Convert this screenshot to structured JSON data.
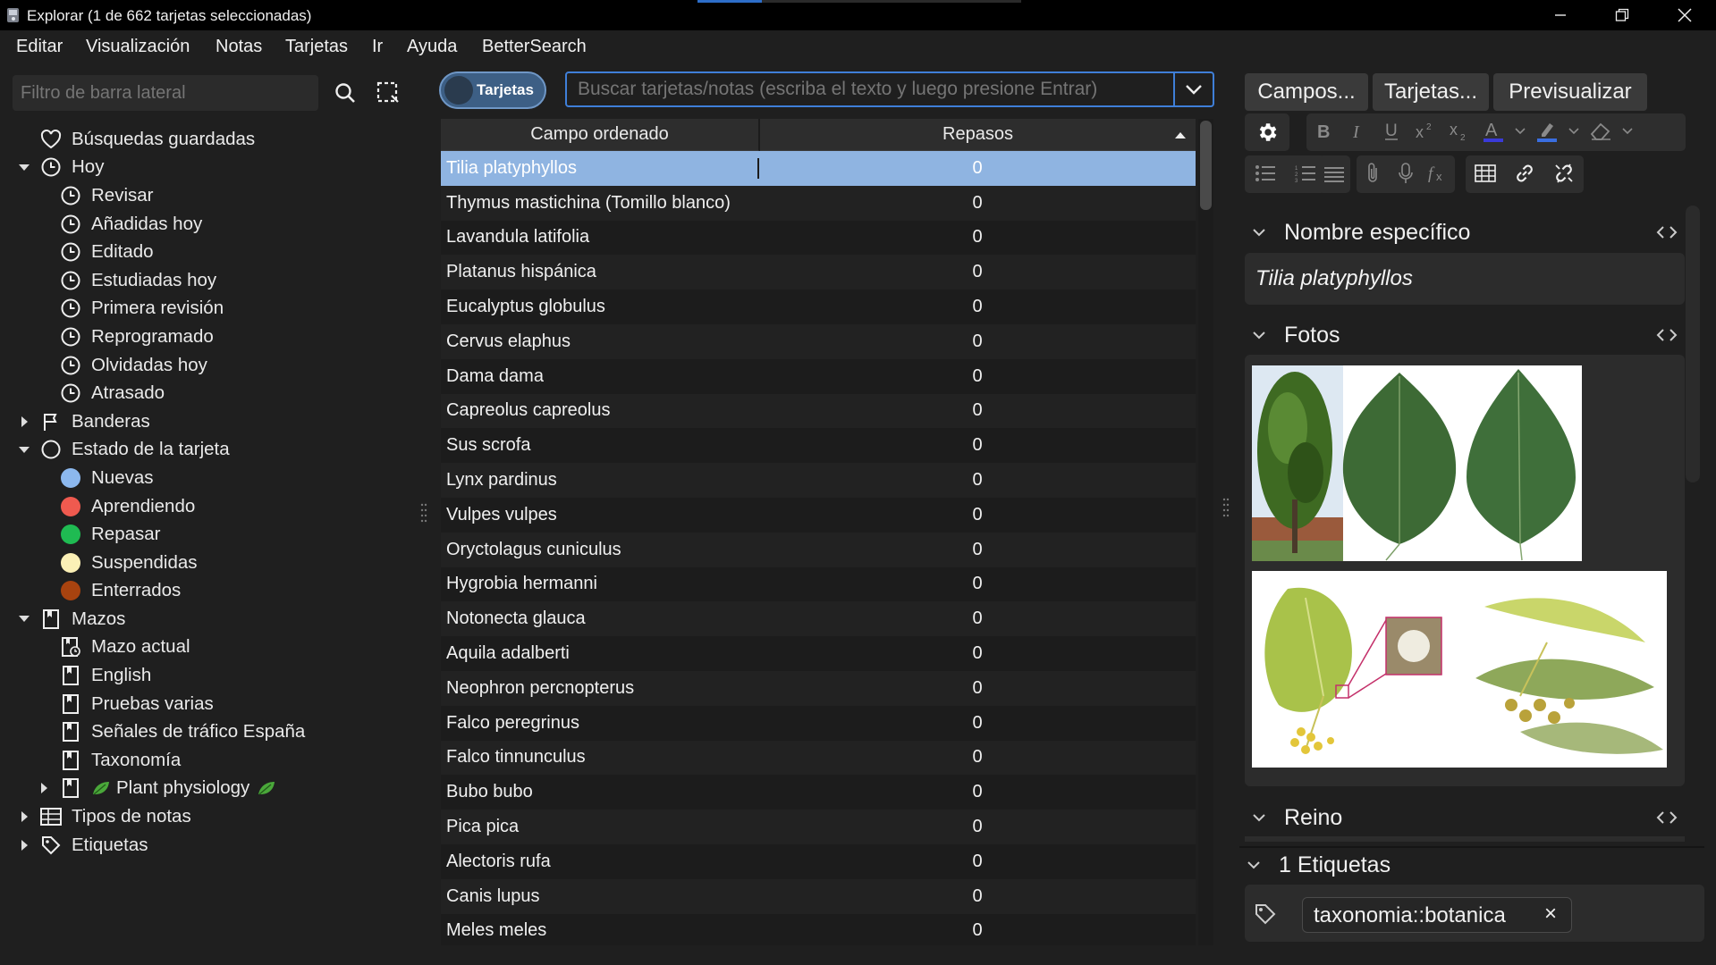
{
  "window": {
    "title": "Explorar (1 de 662 tarjetas seleccionadas)",
    "minimize_icon": "minimize-icon",
    "restore_icon": "restore-icon",
    "close_icon": "close-icon"
  },
  "menu": [
    "Editar",
    "Visualización",
    "Notas",
    "Tarjetas",
    "Ir",
    "Ayuda",
    "BetterSearch"
  ],
  "sidebar": {
    "filter_placeholder": "Filtro de barra lateral",
    "tree": [
      {
        "label": "Búsquedas guardadas",
        "icon": "heart-icon",
        "level": 0,
        "arrow": ""
      },
      {
        "label": "Hoy",
        "icon": "clock-icon",
        "level": 0,
        "arrow": "expanded"
      },
      {
        "label": "Revisar",
        "icon": "clock-icon",
        "level": 1,
        "arrow": ""
      },
      {
        "label": "Añadidas hoy",
        "icon": "clock-icon",
        "level": 1,
        "arrow": ""
      },
      {
        "label": "Editado",
        "icon": "clock-icon",
        "level": 1,
        "arrow": ""
      },
      {
        "label": "Estudiadas hoy",
        "icon": "clock-icon",
        "level": 1,
        "arrow": ""
      },
      {
        "label": "Primera revisión",
        "icon": "clock-icon",
        "level": 1,
        "arrow": ""
      },
      {
        "label": "Reprogramado",
        "icon": "clock-icon",
        "level": 1,
        "arrow": ""
      },
      {
        "label": "Olvidadas hoy",
        "icon": "clock-icon",
        "level": 1,
        "arrow": ""
      },
      {
        "label": "Atrasado",
        "icon": "clock-icon",
        "level": 1,
        "arrow": ""
      },
      {
        "label": "Banderas",
        "icon": "flag-icon",
        "level": 0,
        "arrow": "collapsed"
      },
      {
        "label": "Estado de la tarjeta",
        "icon": "circle-icon",
        "level": 0,
        "arrow": "expanded"
      },
      {
        "label": "Nuevas",
        "icon": "dot-icon",
        "color": "#8cb8ee",
        "level": 1,
        "arrow": ""
      },
      {
        "label": "Aprendiendo",
        "icon": "dot-icon",
        "color": "#ef5a4f",
        "level": 1,
        "arrow": ""
      },
      {
        "label": "Repasar",
        "icon": "dot-icon",
        "color": "#1fbb52",
        "level": 1,
        "arrow": ""
      },
      {
        "label": "Suspendidas",
        "icon": "dot-icon",
        "color": "#fbf0b6",
        "level": 1,
        "arrow": ""
      },
      {
        "label": "Enterrados",
        "icon": "dot-icon",
        "color": "#a8430f",
        "level": 1,
        "arrow": ""
      },
      {
        "label": "Mazos",
        "icon": "deck-icon",
        "level": 0,
        "arrow": "expanded"
      },
      {
        "label": "Mazo actual",
        "icon": "current-deck-icon",
        "level": 1,
        "arrow": ""
      },
      {
        "label": "English",
        "icon": "deck-icon",
        "level": 1,
        "arrow": ""
      },
      {
        "label": "Pruebas varias",
        "icon": "deck-icon",
        "level": 1,
        "arrow": ""
      },
      {
        "label": "Señales de tráfico España",
        "icon": "deck-icon",
        "level": 1,
        "arrow": ""
      },
      {
        "label": "Taxonomía",
        "icon": "deck-icon",
        "level": 1,
        "arrow": ""
      },
      {
        "label": "Plant physiology",
        "icon": "deck-icon",
        "level": 1,
        "arrow": "collapsed",
        "leaf": true
      },
      {
        "label": "Tipos de notas",
        "icon": "notetype-icon",
        "level": 0,
        "arrow": "collapsed"
      },
      {
        "label": "Etiquetas",
        "icon": "tag-icon",
        "level": 0,
        "arrow": "collapsed"
      }
    ]
  },
  "toggle_label": "Tarjetas",
  "search_placeholder": "Buscar tarjetas/notas (escriba el texto y luego presione Entrar)",
  "table": {
    "headers": [
      "Campo ordenado",
      "Repasos"
    ],
    "rows": [
      [
        "Tilia platyphyllos",
        "0"
      ],
      [
        "Thymus mastichina (Tomillo blanco)",
        "0"
      ],
      [
        "Lavandula latifolia",
        "0"
      ],
      [
        "Platanus hispánica",
        "0"
      ],
      [
        "Eucalyptus globulus",
        "0"
      ],
      [
        "Cervus elaphus",
        "0"
      ],
      [
        "Dama dama",
        "0"
      ],
      [
        "Capreolus capreolus",
        "0"
      ],
      [
        "Sus scrofa",
        "0"
      ],
      [
        "Lynx pardinus",
        "0"
      ],
      [
        "Vulpes vulpes",
        "0"
      ],
      [
        "Oryctolagus cuniculus",
        "0"
      ],
      [
        "Hygrobia hermanni",
        "0"
      ],
      [
        "Notonecta glauca",
        "0"
      ],
      [
        "Aquila adalberti",
        "0"
      ],
      [
        "Neophron percnopterus",
        "0"
      ],
      [
        "Falco peregrinus",
        "0"
      ],
      [
        "Falco tinnunculus",
        "0"
      ],
      [
        "Bubo bubo",
        "0"
      ],
      [
        "Pica pica",
        "0"
      ],
      [
        "Alectoris rufa",
        "0"
      ],
      [
        "Canis lupus",
        "0"
      ],
      [
        "Meles meles",
        "0"
      ]
    ],
    "selected_index": 0
  },
  "editor": {
    "buttons": [
      "Campos...",
      "Tarjetas...",
      "Previsualizar"
    ],
    "fields": [
      {
        "name": "Nombre específico",
        "value": "Tilia platyphyllos"
      },
      {
        "name": "Fotos",
        "value": ""
      },
      {
        "name": "Reino",
        "value": ""
      }
    ],
    "tags_header": "1 Etiquetas",
    "tag": "taxonomia::botanica",
    "tag_remove": "×"
  },
  "colors": {
    "accent": "#3f7fd8",
    "selection": "#8fb4e1",
    "toggle": "#3d5f85"
  }
}
